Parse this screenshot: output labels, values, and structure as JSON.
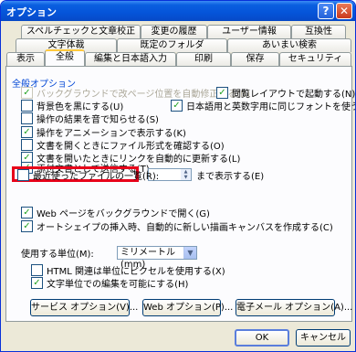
{
  "window": {
    "title": "オプション",
    "help_glyph": "?",
    "close_glyph": "✕"
  },
  "tabs": {
    "row1": [
      "スペルチェックと文章校正",
      "変更の履歴",
      "ユーザー情報",
      "互換性"
    ],
    "row2": [
      "文字体裁",
      "既定のフォルダ",
      "あいまい検索"
    ],
    "row3": [
      "表示",
      "全般",
      "編集と日本語入力",
      "印刷",
      "保存",
      "セキュリティ"
    ],
    "active": "全般"
  },
  "general": {
    "group_label": "全般オプション",
    "options": {
      "background_repaginate": {
        "label": "バックグラウンドで改ページ位置を自動修正する(B)",
        "checked": true,
        "enabled": false
      },
      "reading_layout": {
        "label": "閲覧レイアウトで起動する(N)",
        "checked": true,
        "enabled": true
      },
      "blue_background": {
        "label": "背景色を黒にする(U)",
        "checked": false,
        "enabled": true
      },
      "same_font": {
        "label": "日本語用と英数字用に同じフォントを使う(F)",
        "checked": true,
        "enabled": true
      },
      "sound_feedback": {
        "label": "操作の結果を音で知らせる(S)",
        "checked": false,
        "enabled": true
      },
      "animate": {
        "label": "操作をアニメーションで表示する(K)",
        "checked": true,
        "enabled": true
      },
      "confirm_convert": {
        "label": "文書を開くときにファイル形式を確認する(O)",
        "checked": false,
        "enabled": true
      },
      "update_links": {
        "label": "文書を開いたときにリンクを自動的に更新する(L)",
        "checked": true,
        "enabled": true
      },
      "send_attachment": {
        "label": "添付文書として送信する(T)",
        "checked": true,
        "enabled": true
      },
      "recent_files": {
        "label": "最近使ったファイルの一覧(R):",
        "checked": false,
        "enabled": true
      },
      "recent_files_count": "",
      "recent_files_suffix": "まで表示する(E)",
      "web_background": {
        "label": "Web ページをバックグラウンドで開く(G)",
        "checked": true,
        "enabled": true
      },
      "auto_canvas": {
        "label": "オートシェイプの挿入時、自動的に新しい描画キャンバスを作成する(C)",
        "checked": true,
        "enabled": true
      },
      "units_label": "使用する単位(M):",
      "units_value": "ミリメートル (mm)",
      "html_pixels": {
        "label": "HTML 関連は単位にピクセルを使用する(X)",
        "checked": false,
        "enabled": true
      },
      "char_units": {
        "label": "文字単位での編集を可能にする(H)",
        "checked": true,
        "enabled": true
      }
    }
  },
  "buttons": {
    "service_options": "サービス オプション(V)...",
    "web_options": "Web オプション(P)...",
    "email_options": "電子メール オプション(A)...",
    "ok": "OK",
    "cancel": "キャンセル"
  },
  "colors": {
    "title_bar": "#0554d9",
    "group_label": "#0046d5",
    "highlight_box": "#e8001a",
    "check_mark": "#21a121"
  }
}
